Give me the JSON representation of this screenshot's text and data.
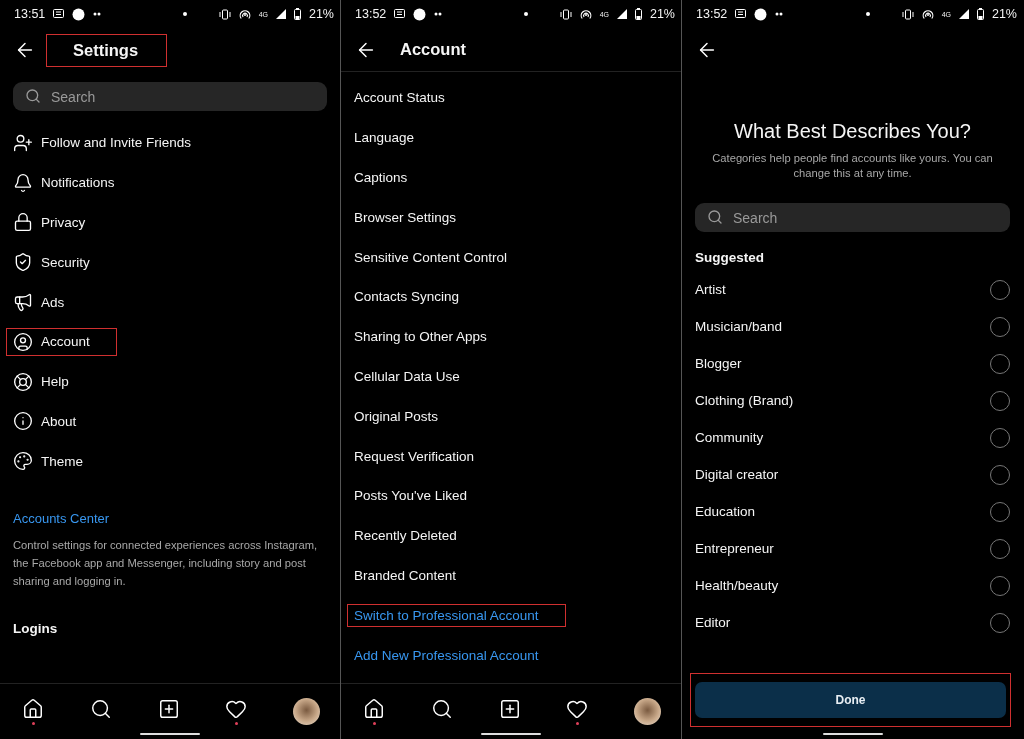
{
  "screens": [
    {
      "status_bar": {
        "time": "13:51",
        "network": "4G",
        "battery": "21%"
      },
      "header": {
        "title": "Settings",
        "highlighted": true
      },
      "search": {
        "placeholder": "Search"
      },
      "items": [
        {
          "label": "Follow and Invite Friends",
          "highlighted": false
        },
        {
          "label": "Notifications",
          "highlighted": false
        },
        {
          "label": "Privacy",
          "highlighted": false
        },
        {
          "label": "Security",
          "highlighted": false
        },
        {
          "label": "Ads",
          "highlighted": false
        },
        {
          "label": "Account",
          "highlighted": true
        },
        {
          "label": "Help",
          "highlighted": false
        },
        {
          "label": "About",
          "highlighted": false
        },
        {
          "label": "Theme",
          "highlighted": false
        }
      ],
      "accounts_center": {
        "link": "Accounts Center",
        "description": "Control settings for connected experiences across Instagram, the Facebook app and Messenger, including story and post sharing and logging in."
      },
      "section_title": "Logins"
    },
    {
      "status_bar": {
        "time": "13:52",
        "network": "4G",
        "battery": "21%"
      },
      "header": {
        "title": "Account",
        "highlighted": false
      },
      "items": [
        {
          "label": "Account Status",
          "kind": "plain",
          "highlighted": false
        },
        {
          "label": "Language",
          "kind": "plain",
          "highlighted": false
        },
        {
          "label": "Captions",
          "kind": "plain",
          "highlighted": false
        },
        {
          "label": "Browser Settings",
          "kind": "plain",
          "highlighted": false
        },
        {
          "label": "Sensitive Content Control",
          "kind": "plain",
          "highlighted": false
        },
        {
          "label": "Contacts Syncing",
          "kind": "plain",
          "highlighted": false
        },
        {
          "label": "Sharing to Other Apps",
          "kind": "plain",
          "highlighted": false
        },
        {
          "label": "Cellular Data Use",
          "kind": "plain",
          "highlighted": false
        },
        {
          "label": "Original Posts",
          "kind": "plain",
          "highlighted": false
        },
        {
          "label": "Request Verification",
          "kind": "plain",
          "highlighted": false
        },
        {
          "label": "Posts You've Liked",
          "kind": "plain",
          "highlighted": false
        },
        {
          "label": "Recently Deleted",
          "kind": "plain",
          "highlighted": false
        },
        {
          "label": "Branded Content",
          "kind": "plain",
          "highlighted": false
        },
        {
          "label": "Switch to Professional Account",
          "kind": "link",
          "highlighted": true
        },
        {
          "label": "Add New Professional Account",
          "kind": "link",
          "highlighted": false
        }
      ]
    },
    {
      "status_bar": {
        "time": "13:52",
        "network": "4G",
        "battery": "21%"
      },
      "title": "What Best Describes You?",
      "subtitle": "Categories help people find accounts like yours. You can change this at any time.",
      "search": {
        "placeholder": "Search"
      },
      "section_title": "Suggested",
      "options": [
        {
          "label": "Artist",
          "selected": false
        },
        {
          "label": "Musician/band",
          "selected": false
        },
        {
          "label": "Blogger",
          "selected": false
        },
        {
          "label": "Clothing (Brand)",
          "selected": false
        },
        {
          "label": "Community",
          "selected": false
        },
        {
          "label": "Digital creator",
          "selected": false
        },
        {
          "label": "Education",
          "selected": false
        },
        {
          "label": "Entrepreneur",
          "selected": false
        },
        {
          "label": "Health/beauty",
          "selected": false
        },
        {
          "label": "Editor",
          "selected": false
        }
      ],
      "done": {
        "label": "Done",
        "highlighted": true
      }
    }
  ]
}
